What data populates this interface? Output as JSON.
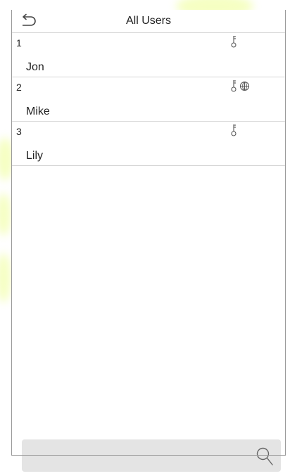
{
  "header": {
    "title": "All Users",
    "back_icon": "back-arrow-icon"
  },
  "users": [
    {
      "id": "1",
      "name": "Jon",
      "icons": [
        "password-key-icon"
      ]
    },
    {
      "id": "2",
      "name": "Mike",
      "icons": [
        "password-key-icon",
        "face-icon"
      ]
    },
    {
      "id": "3",
      "name": "Lily",
      "icons": [
        "password-key-icon"
      ]
    }
  ],
  "search": {
    "value": "",
    "placeholder": "",
    "icon": "search-icon"
  },
  "colors": {
    "divider": "#d6d6d6",
    "search_background": "#e4e4e4",
    "watermark": "#eaff7a"
  }
}
